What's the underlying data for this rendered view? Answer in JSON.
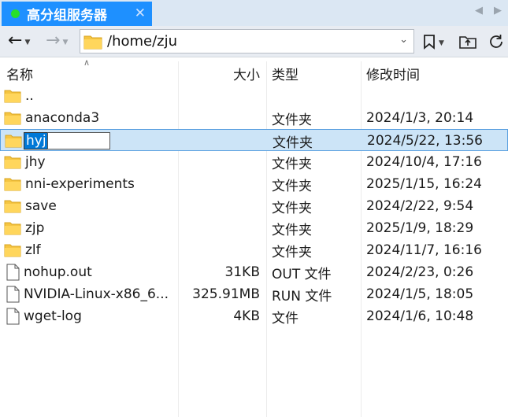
{
  "tab": {
    "title": "高分组服务器",
    "close": "✕",
    "status_color": "#27e02a",
    "accent": "#1e90ff"
  },
  "toolbar": {
    "path": "/home/zju"
  },
  "columns": {
    "name": "名称",
    "size": "大小",
    "type": "类型",
    "modified": "修改时间"
  },
  "files": [
    {
      "name": "..",
      "size": "",
      "type": "",
      "modified": "",
      "icon": "folder-icon"
    },
    {
      "name": "anaconda3",
      "size": "",
      "type": "文件夹",
      "modified": "2024/1/3, 20:14",
      "icon": "folder-icon"
    },
    {
      "name": "hyj",
      "size": "",
      "type": "文件夹",
      "modified": "2024/5/22, 13:56",
      "icon": "folder-icon",
      "selected": true,
      "editing": true
    },
    {
      "name": "jhy",
      "size": "",
      "type": "文件夹",
      "modified": "2024/10/4, 17:16",
      "icon": "folder-icon"
    },
    {
      "name": "nni-experiments",
      "size": "",
      "type": "文件夹",
      "modified": "2025/1/15, 16:24",
      "icon": "folder-icon"
    },
    {
      "name": "save",
      "size": "",
      "type": "文件夹",
      "modified": "2024/2/22, 9:54",
      "icon": "folder-icon"
    },
    {
      "name": "zjp",
      "size": "",
      "type": "文件夹",
      "modified": "2025/1/9, 18:29",
      "icon": "folder-icon"
    },
    {
      "name": "zlf",
      "size": "",
      "type": "文件夹",
      "modified": "2024/11/7, 16:16",
      "icon": "folder-icon"
    },
    {
      "name": "nohup.out",
      "size": "31KB",
      "type": "OUT 文件",
      "modified": "2024/2/23, 0:26",
      "icon": "file-icon"
    },
    {
      "name": "NVIDIA-Linux-x86_6...",
      "size": "325.91MB",
      "type": "RUN 文件",
      "modified": "2024/1/5, 18:05",
      "icon": "file-icon"
    },
    {
      "name": "wget-log",
      "size": "4KB",
      "type": "文件",
      "modified": "2024/1/6, 10:48",
      "icon": "file-icon"
    }
  ]
}
